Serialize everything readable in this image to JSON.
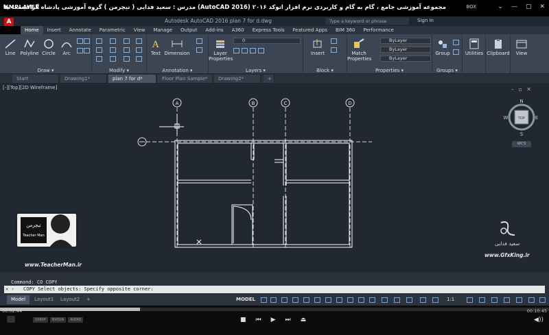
{
  "player": {
    "logo": "KMPLAYER",
    "course_title": "مجموعه آموزشی جامع ، گام به گام و کاربردی نرم افزار  اتوکد ۲۰۱۶ (AutoCAD 2016)  مدرس : سعید فدایی ( تیچرمن ) گروه آموزشی پادشاه گرافیست ها",
    "box_label": "BOX",
    "controls": [
      "⌄",
      "—",
      "▢",
      "✕"
    ],
    "time_elapsed": "00:02:44",
    "time_total": "00:10:45",
    "progress_fraction": 0.255,
    "badges": [
      "1080P",
      "NVIDIA",
      "AUDIO"
    ],
    "play_controls": [
      "■",
      "⏮",
      "▶",
      "⏭",
      "⏏"
    ],
    "volume_icon": "◀))"
  },
  "acad": {
    "file_title": "Autodesk AutoCAD 2016    plan 7 for d.dwg",
    "search_placeholder": "Type a keyword or phrase",
    "sign_in": "Sign In",
    "ribbon_tabs": [
      "Home",
      "Insert",
      "Annotate",
      "Parametric",
      "View",
      "Manage",
      "Output",
      "Add-ins",
      "A360",
      "Express Tools",
      "Featured Apps",
      "BIM 360",
      "Performance"
    ],
    "panels": {
      "draw": {
        "title": "Draw ▾",
        "buttons": [
          "Line",
          "Polyline",
          "Circle",
          "Arc"
        ]
      },
      "modify": {
        "title": "Modify ▾"
      },
      "annotation": {
        "title": "Annotation ▾",
        "buttons": [
          "Text",
          "Dimension"
        ]
      },
      "layers": {
        "title": "Layers ▾",
        "button": "Layer Properties",
        "current_layer": "0"
      },
      "block": {
        "title": "Block ▾",
        "button": "Insert"
      },
      "properties": {
        "title": "Properties ▾",
        "button": "Match Properties",
        "bylayer": [
          "ByLayer",
          "ByLayer",
          "ByLayer"
        ]
      },
      "groups": {
        "title": "Groups ▾",
        "button": "Group"
      },
      "utilities": {
        "button": "Utilities"
      },
      "clipboard": {
        "button": "Clipboard"
      },
      "view": {
        "button": "View"
      }
    },
    "file_tabs": [
      "Start",
      "Drawing1*",
      "plan 7 for d*",
      "Floor Plan Sample*",
      "Drawing2*",
      "+"
    ],
    "active_file_tab": "plan 7 for d*",
    "viewport_label": "[-][Top][2D Wireframe]",
    "viewport_controls": "– ▫ ✕",
    "viewcube": {
      "top": "TOP",
      "n": "N",
      "s": "S",
      "e": "E",
      "w": "W",
      "wcs": "WCS"
    },
    "grid_labels": [
      "A",
      "B",
      "C",
      "D"
    ],
    "command_history": "Command: CO COPY",
    "command_prompt": "COPY Select objects: Specify opposite corner:",
    "layout_tabs": [
      "Model",
      "Layout1",
      "Layout2",
      "+"
    ],
    "status_model": "MODEL",
    "scale": "1:1"
  },
  "watermarks": {
    "teacher_badge_title": "تیچرمن",
    "teacher_badge_sub": "Teacher Man",
    "teacher_url": "www.TeacherMan.ir",
    "gfx_name": "سعید فدایی",
    "gfx_url": "www.GfxKing.ir"
  },
  "colors": {
    "cad_background": "#212832",
    "ribbon": "#3b4553",
    "plan_lines": "#ffffff",
    "accent_red": "#cc1111"
  }
}
